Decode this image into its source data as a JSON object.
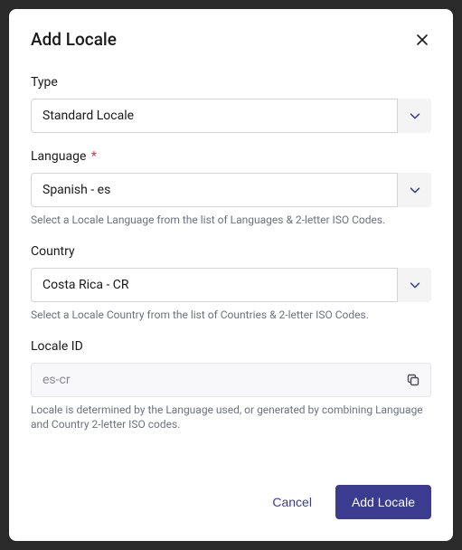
{
  "modal": {
    "title": "Add Locale",
    "fields": {
      "type": {
        "label": "Type",
        "value": "Standard Locale"
      },
      "language": {
        "label": "Language",
        "required": "*",
        "value": "Spanish - es",
        "help": "Select a Locale Language from the list of Languages & 2-letter ISO Codes."
      },
      "country": {
        "label": "Country",
        "value": "Costa Rica - CR",
        "help": "Select a Locale Country from the list of Countries & 2-letter ISO Codes."
      },
      "locale_id": {
        "label": "Locale ID",
        "value": "es-cr",
        "help": "Locale is determined by the Language used, or generated by combining Language and Country 2-letter ISO codes."
      }
    },
    "footer": {
      "cancel": "Cancel",
      "submit": "Add Locale"
    }
  }
}
